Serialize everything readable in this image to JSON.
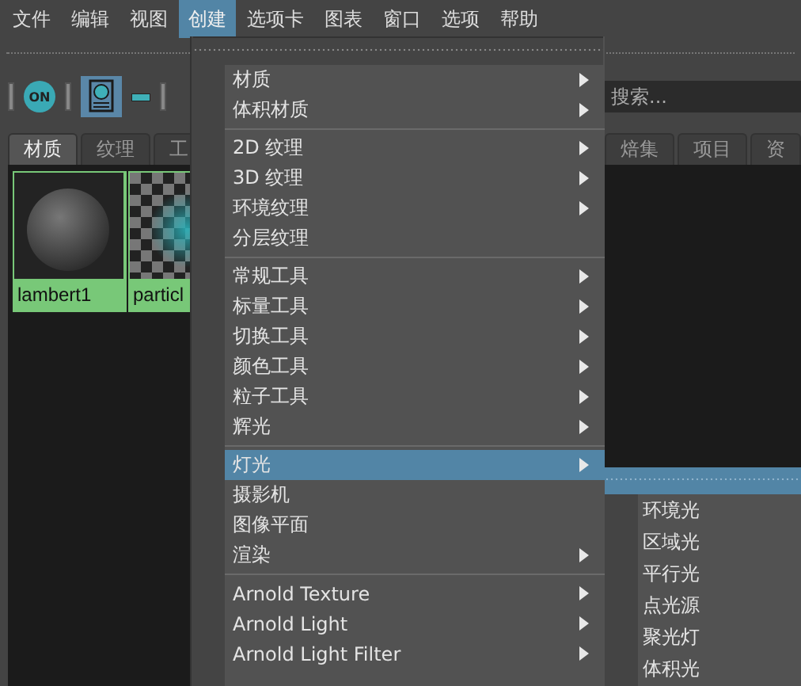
{
  "menu_bar": [
    {
      "label": "文件",
      "selected": false
    },
    {
      "label": "编辑",
      "selected": false
    },
    {
      "label": "视图",
      "selected": false
    },
    {
      "label": "创建",
      "selected": true
    },
    {
      "label": "选项卡",
      "selected": false
    },
    {
      "label": "图表",
      "selected": false
    },
    {
      "label": "窗口",
      "selected": false
    },
    {
      "label": "选项",
      "selected": false
    },
    {
      "label": "帮助",
      "selected": false
    }
  ],
  "toolbar": {
    "on_button": "ON"
  },
  "search": {
    "placeholder": "搜索..."
  },
  "tabs": [
    {
      "label": "材质",
      "selected": true
    },
    {
      "label": "纹理",
      "selected": false
    },
    {
      "label": "工",
      "selected": false
    },
    {
      "label": "焙集",
      "selected": false
    },
    {
      "label": "项目",
      "selected": false
    },
    {
      "label": "资",
      "selected": false
    }
  ],
  "swatches": [
    {
      "label": "lambert1",
      "kind": "sphere",
      "selected": true
    },
    {
      "label": "particl",
      "kind": "checker",
      "selected": true
    }
  ],
  "create_menu": [
    {
      "kind": "item",
      "label": "材质",
      "has_submenu": true,
      "selected": false
    },
    {
      "kind": "item",
      "label": "体积材质",
      "has_submenu": true,
      "selected": false
    },
    {
      "kind": "separator"
    },
    {
      "kind": "item",
      "label": "2D 纹理",
      "has_submenu": true,
      "selected": false
    },
    {
      "kind": "item",
      "label": "3D 纹理",
      "has_submenu": true,
      "selected": false
    },
    {
      "kind": "item",
      "label": "环境纹理",
      "has_submenu": true,
      "selected": false
    },
    {
      "kind": "item",
      "label": "分层纹理",
      "has_submenu": false,
      "selected": false
    },
    {
      "kind": "separator"
    },
    {
      "kind": "item",
      "label": "常规工具",
      "has_submenu": true,
      "selected": false
    },
    {
      "kind": "item",
      "label": "标量工具",
      "has_submenu": true,
      "selected": false
    },
    {
      "kind": "item",
      "label": "切换工具",
      "has_submenu": true,
      "selected": false
    },
    {
      "kind": "item",
      "label": "颜色工具",
      "has_submenu": true,
      "selected": false
    },
    {
      "kind": "item",
      "label": "粒子工具",
      "has_submenu": true,
      "selected": false
    },
    {
      "kind": "item",
      "label": "辉光",
      "has_submenu": true,
      "selected": false
    },
    {
      "kind": "separator"
    },
    {
      "kind": "item",
      "label": "灯光",
      "has_submenu": true,
      "selected": true
    },
    {
      "kind": "item",
      "label": "摄影机",
      "has_submenu": false,
      "selected": false
    },
    {
      "kind": "item",
      "label": "图像平面",
      "has_submenu": false,
      "selected": false
    },
    {
      "kind": "item",
      "label": "渲染",
      "has_submenu": true,
      "selected": false
    },
    {
      "kind": "separator"
    },
    {
      "kind": "item",
      "label": "Arnold Texture",
      "has_submenu": true,
      "selected": false
    },
    {
      "kind": "item",
      "label": "Arnold Light",
      "has_submenu": true,
      "selected": false
    },
    {
      "kind": "item",
      "label": "Arnold Light Filter",
      "has_submenu": true,
      "selected": false
    }
  ],
  "lights_submenu": [
    {
      "label": "环境光"
    },
    {
      "label": "区域光"
    },
    {
      "label": "平行光"
    },
    {
      "label": "点光源"
    },
    {
      "label": "聚光灯"
    },
    {
      "label": "体积光"
    }
  ]
}
